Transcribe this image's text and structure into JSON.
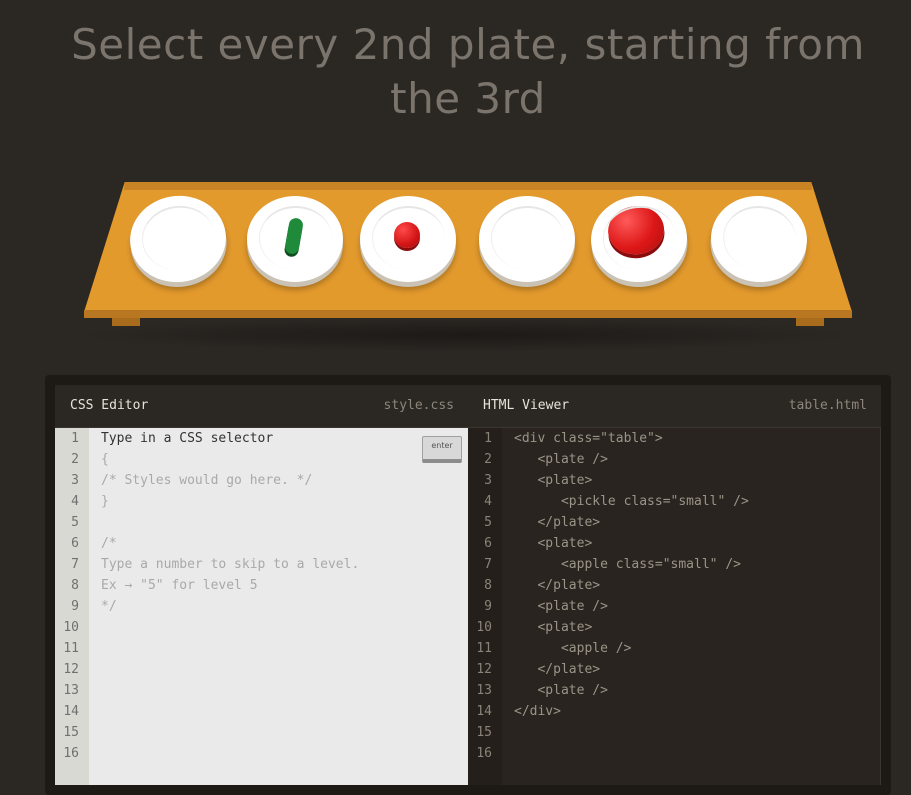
{
  "level": {
    "instruction": "Select every 2nd plate, starting from the 3rd"
  },
  "colors": {
    "background": "#2b2723",
    "table": "#e39a2d",
    "apple": "#dd1717",
    "pickle": "#1f8a3a"
  },
  "css_editor": {
    "title": "CSS Editor",
    "filename": "style.css",
    "enter_label": "enter",
    "line_numbers": [
      "1",
      "2",
      "3",
      "4",
      "5",
      "6",
      "7",
      "8",
      "9",
      "10",
      "11",
      "12",
      "13",
      "14",
      "15",
      "16"
    ],
    "lines": [
      "Type in a CSS selector",
      "{",
      "/* Styles would go here. */",
      "}",
      "",
      "/*",
      "Type a number to skip to a level.",
      "Ex → \"5\" for level 5",
      "*/"
    ]
  },
  "html_viewer": {
    "title": "HTML Viewer",
    "filename": "table.html",
    "line_numbers": [
      "1",
      "2",
      "3",
      "4",
      "5",
      "6",
      "7",
      "8",
      "9",
      "10",
      "11",
      "12",
      "13",
      "14",
      "15",
      "16"
    ],
    "lines": [
      "<div class=\"table\">",
      "   <plate />",
      "   <plate>",
      "      <pickle class=\"small\" />",
      "   </plate>",
      "   <plate>",
      "      <apple class=\"small\" />",
      "   </plate>",
      "   <plate />",
      "   <plate>",
      "      <apple />",
      "   </plate>",
      "   <plate />",
      "</div>"
    ]
  }
}
